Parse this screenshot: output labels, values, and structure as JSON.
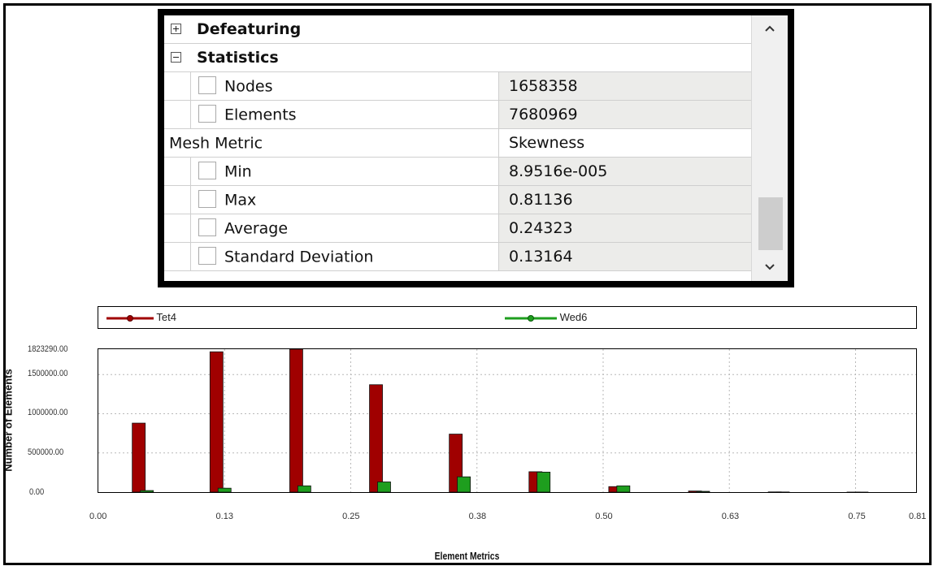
{
  "panel": {
    "groups": [
      {
        "label": "Defeaturing",
        "expanded": false
      },
      {
        "label": "Statistics",
        "expanded": true
      }
    ],
    "rows": [
      {
        "label": "Nodes",
        "value": "1658358",
        "checkbox": true
      },
      {
        "label": "Elements",
        "value": "7680969",
        "checkbox": true
      },
      {
        "label": "Mesh Metric",
        "value": "Skewness",
        "checkbox": false
      },
      {
        "label": "Min",
        "value": "8.9516e-005",
        "checkbox": true
      },
      {
        "label": "Max",
        "value": "0.81136",
        "checkbox": true
      },
      {
        "label": "Average",
        "value": "0.24323",
        "checkbox": true
      },
      {
        "label": "Standard Deviation",
        "value": "0.13164",
        "checkbox": true
      }
    ],
    "scroll_up_icon": "chevron-up-icon",
    "scroll_down_icon": "chevron-down-icon"
  },
  "chart_data": {
    "type": "bar",
    "title": "",
    "xlabel": "Element Metrics",
    "ylabel": "Number of Elements",
    "xlim": [
      0.0,
      0.81
    ],
    "ylim": [
      0,
      1823290
    ],
    "x_ticks": [
      "0.00",
      "0.13",
      "0.25",
      "0.38",
      "0.50",
      "0.63",
      "0.75",
      "0.81"
    ],
    "y_ticks": [
      "0.00",
      "500000.00",
      "1000000.00",
      "1500000.00",
      "1823290.00"
    ],
    "grid": true,
    "legend_position": "top",
    "colors": {
      "Tet4": "#a00000",
      "Wed6": "#1e9e1e"
    },
    "series": [
      {
        "name": "Tet4",
        "x": [
          0.04,
          0.117,
          0.196,
          0.275,
          0.354,
          0.433,
          0.512,
          0.591,
          0.67,
          0.748
        ],
        "values": [
          880000,
          1790000,
          1823290,
          1370000,
          740000,
          260000,
          70000,
          14000,
          2500,
          400
        ]
      },
      {
        "name": "Wed6",
        "x": [
          0.048,
          0.125,
          0.204,
          0.283,
          0.362,
          0.441,
          0.52,
          0.599,
          0.678,
          0.756
        ],
        "values": [
          20000,
          50000,
          80000,
          130000,
          195000,
          255000,
          80000,
          10000,
          1500,
          300
        ]
      }
    ]
  }
}
